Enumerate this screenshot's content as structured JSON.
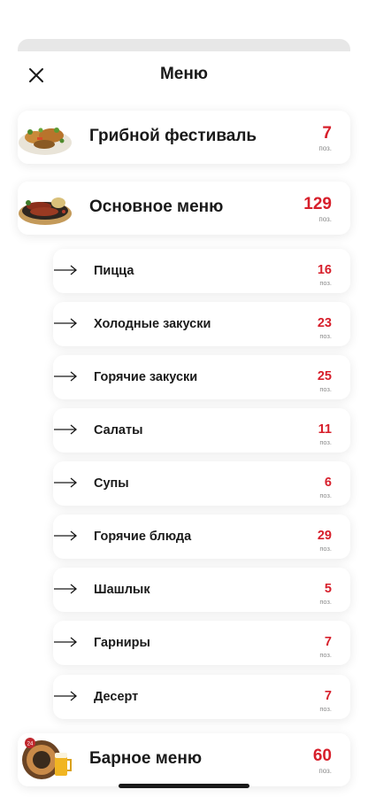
{
  "header": {
    "title": "Меню",
    "close_icon": "close-icon"
  },
  "colors": {
    "accent": "#d71f2b",
    "muted": "#8a8a8a",
    "text": "#1a1a1a"
  },
  "categories": [
    {
      "name": "Грибной фестиваль",
      "count": "7",
      "unit": "поз.",
      "icon": "mushroom-dish-photo"
    },
    {
      "name": "Основное меню",
      "count": "129",
      "unit": "поз.",
      "icon": "sausage-dish-photo"
    },
    {
      "name": "Барное меню",
      "count": "60",
      "unit": "поз.",
      "icon": "bar-logo-photo",
      "badge": "24"
    }
  ],
  "subcategories": [
    {
      "name": "Пицца",
      "count": "16",
      "unit": "поз."
    },
    {
      "name": "Холодные закуски",
      "count": "23",
      "unit": "поз."
    },
    {
      "name": "Горячие закуски",
      "count": "25",
      "unit": "поз."
    },
    {
      "name": "Салаты",
      "count": "11",
      "unit": "поз."
    },
    {
      "name": "Супы",
      "count": "6",
      "unit": "поз."
    },
    {
      "name": "Горячие блюда",
      "count": "29",
      "unit": "поз."
    },
    {
      "name": "Шашлык",
      "count": "5",
      "unit": "поз."
    },
    {
      "name": "Гарниры",
      "count": "7",
      "unit": "поз."
    },
    {
      "name": "Десерт",
      "count": "7",
      "unit": "поз."
    }
  ]
}
